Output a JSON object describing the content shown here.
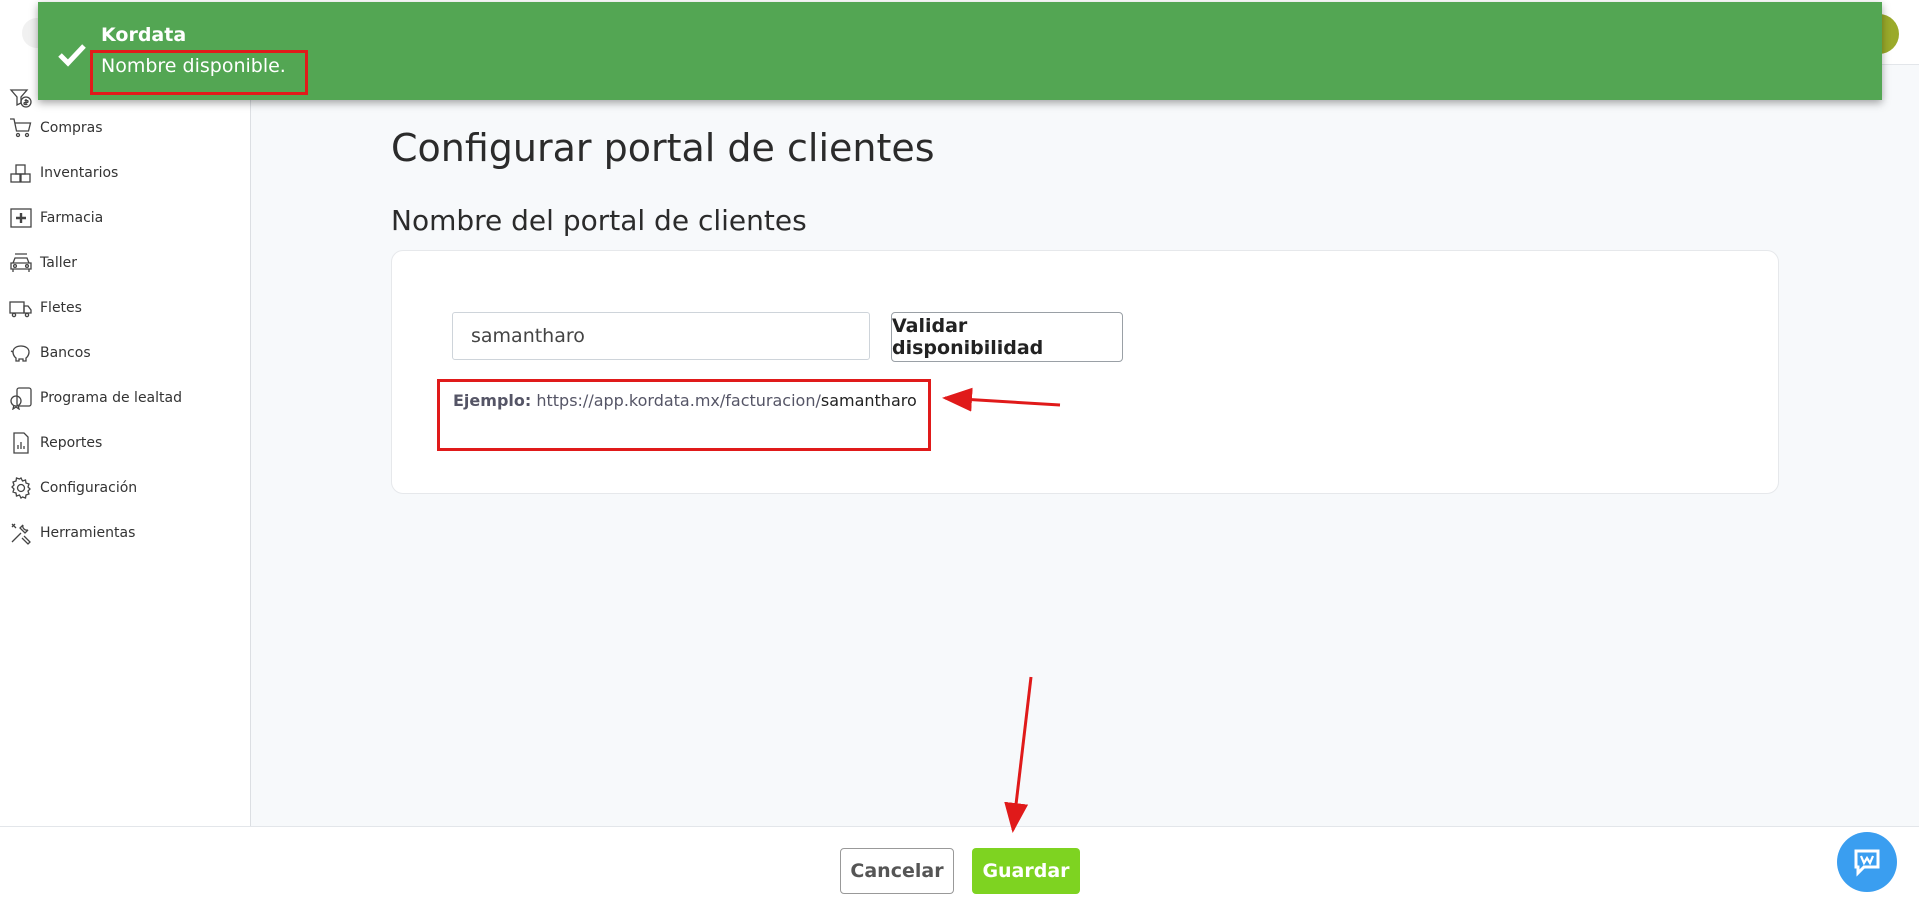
{
  "toast": {
    "title": "Kordata",
    "message": "Nombre disponible."
  },
  "sidebar": {
    "items": [
      {
        "label": "Compras",
        "icon": "cart-icon"
      },
      {
        "label": "Inventarios",
        "icon": "boxes-icon"
      },
      {
        "label": "Farmacia",
        "icon": "pharmacy-cross-icon"
      },
      {
        "label": "Taller",
        "icon": "car-icon"
      },
      {
        "label": "Fletes",
        "icon": "truck-icon"
      },
      {
        "label": "Bancos",
        "icon": "piggy-bank-icon"
      },
      {
        "label": "Programa de lealtad",
        "icon": "loyalty-badge-icon"
      },
      {
        "label": "Reportes",
        "icon": "report-icon"
      },
      {
        "label": "Configuración",
        "icon": "gear-icon"
      },
      {
        "label": "Herramientas",
        "icon": "tools-icon"
      }
    ]
  },
  "main": {
    "page_title": "Configurar portal de clientes",
    "section_title": "Nombre del portal de clientes",
    "portal_name_value": "samantharo",
    "validate_label": "Validar disponibilidad",
    "example_label": "Ejemplo:",
    "example_url": "https://app.kordata.mx/facturacion/",
    "example_slug": "samantharo"
  },
  "footer": {
    "cancel_label": "Cancelar",
    "save_label": "Guardar"
  },
  "colors": {
    "toast_bg": "#53a653",
    "save_bg": "#7ed321",
    "annotation_red": "#e01a1a",
    "chat_bg": "#3a9ef0"
  }
}
